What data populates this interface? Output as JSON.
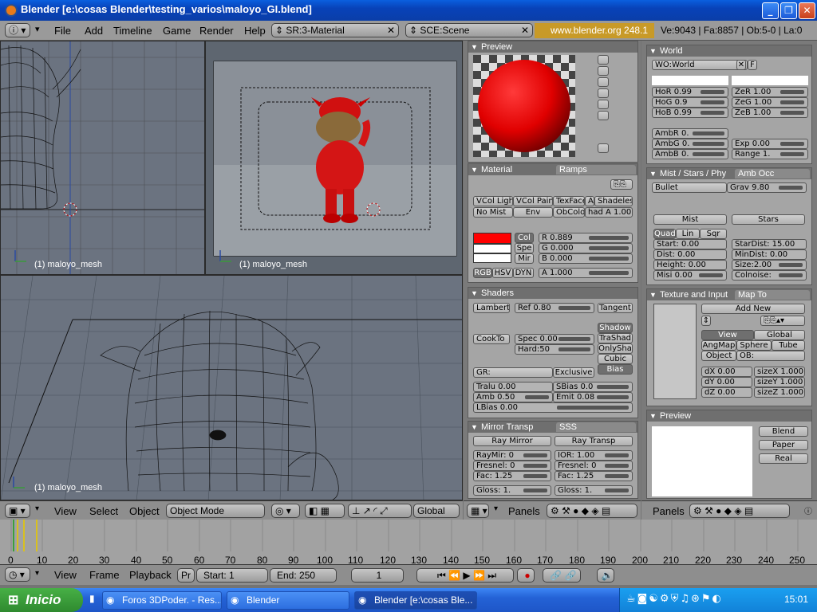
{
  "window": {
    "title": "Blender [e:\\cosas Blender\\testing_varios\\maloyo_GI.blend]"
  },
  "menu": [
    "File",
    "Add",
    "Timeline",
    "Game",
    "Render",
    "Help"
  ],
  "screen_selector": "SR:3-Material",
  "scene_selector": "SCE:Scene",
  "info_url": "www.blender.org 248.1",
  "info_stats": "Ve:9043 | Fa:8857 | Ob:5-0 | La:0",
  "viewports": {
    "top_left_label": "(1) maloyo_mesh",
    "top_right_label": "(1) maloyo_mesh",
    "bottom_label": "(1) maloyo_mesh"
  },
  "view3d_header": {
    "view": "View",
    "select": "Select",
    "object": "Object",
    "mode": "Object Mode",
    "orientation": "Global"
  },
  "preview_panel": {
    "title": "Preview"
  },
  "material_panel": {
    "tab": "Material",
    "tab2": "Ramps",
    "row1": [
      "VCol Ligh",
      "VCol Pain",
      "TexFace",
      "A",
      "Shadeles"
    ],
    "row2": [
      "No Mist",
      "Env",
      "ObColo",
      "had A 1.00"
    ],
    "col_btns": [
      "Col",
      "Spe",
      "Mir"
    ],
    "r": "R 0.889",
    "g": "G 0.000",
    "b": "B 0.000",
    "a": "A 1.000",
    "color_modes": [
      "RGB",
      "HSV",
      "DYN"
    ],
    "color_r": 0.889,
    "color_g": 0.0,
    "color_b": 0.0
  },
  "shaders_panel": {
    "title": "Shaders",
    "diffuse": "Lambert",
    "ref": "Ref  0.80",
    "tangent": "Tangent",
    "specular": "CookTo",
    "spec": "Spec 0.00",
    "hard": "Hard:50",
    "toggles": [
      "Shadow",
      "TraShad",
      "OnlySha",
      "Cubic",
      "Bias"
    ],
    "gr": "GR:",
    "exclusive": "Exclusive",
    "tralu": "Tralu 0.00",
    "sbias": "SBias 0.0",
    "amb": "Amb 0.50",
    "emit": "Emit 0.08",
    "lbias": "LBias 0.00"
  },
  "mirror_panel": {
    "tab": "Mirror Transp",
    "tab2": "SSS",
    "ray_mirror": "Ray Mirror",
    "ray_transp": "Ray Transp",
    "left": [
      "RayMir: 0",
      "Fresnel: 0",
      "Fac: 1.25"
    ],
    "right": [
      "IOR: 1.00",
      "Fresnel: 0",
      "Fac: 1.25"
    ],
    "gloss1": "Gloss: 1.",
    "gloss2": "Gloss: 1."
  },
  "world_panel": {
    "title": "World",
    "name": "WO:World",
    "f": "F",
    "left": [
      "HoR 0.99",
      "HoG 0.9",
      "HoB 0.99"
    ],
    "right": [
      "ZeR 1.00",
      "ZeG 1.00",
      "ZeB 1.00"
    ],
    "amb": [
      "AmbR 0.",
      "AmbG 0.",
      "AmbB 0."
    ],
    "exp": "Exp 0.00",
    "range": "Range 1."
  },
  "mist_panel": {
    "tab": "Mist / Stars / Phy",
    "tab2": "Amb Occ",
    "physics": "Bullet",
    "grav": "Grav 9.80",
    "mist": "Mist",
    "stars": "Stars",
    "falloff": [
      "Quad",
      "Lin",
      "Sqr"
    ],
    "left": [
      "Start: 0.00",
      "Dist: 0.00",
      "Height: 0.00",
      "Misi 0.00"
    ],
    "right": [
      "StarDist: 15.00",
      "MinDist: 0.00",
      "Size:2.00",
      "Colnoise:"
    ]
  },
  "texture_panel": {
    "tab": "Texture and Input",
    "tab2": "Map To",
    "add_new": "Add New",
    "view": "View",
    "global": "Global",
    "maps": [
      "AngMap",
      "Sphere",
      "Tube"
    ],
    "object": "Object",
    "ob": "OB:",
    "d": [
      "dX 0.00",
      "dY 0.00",
      "dZ 0.00"
    ],
    "size": [
      "sizeX 1.000",
      "sizeY 1.000",
      "sizeZ 1.000"
    ]
  },
  "world_preview": {
    "title": "Preview",
    "buttons": [
      "Blend",
      "Paper",
      "Real"
    ]
  },
  "buttons_header": {
    "panels_left": "Panels",
    "panels_right": "Panels"
  },
  "timeline": {
    "ticks": [
      "0",
      "10",
      "20",
      "30",
      "40",
      "50",
      "60",
      "70",
      "80",
      "90",
      "100",
      "110",
      "120",
      "130",
      "140",
      "150",
      "160",
      "170",
      "180",
      "190",
      "200",
      "210",
      "220",
      "230",
      "240",
      "250"
    ],
    "view": "View",
    "frame": "Frame",
    "playback": "Playback",
    "pr": "Pr",
    "start": "Start: 1",
    "end": "End: 250",
    "current": "1"
  },
  "taskbar": {
    "start": "Inicio",
    "tasks": [
      "Foros 3DPoder. - Res...",
      "Blender",
      "Blender [e:\\cosas Ble..."
    ],
    "clock": "15:01"
  },
  "colors": {
    "accent": "#ff0000",
    "xp_blue": "#2462d6",
    "blender_gray": "#a5a5a5"
  }
}
